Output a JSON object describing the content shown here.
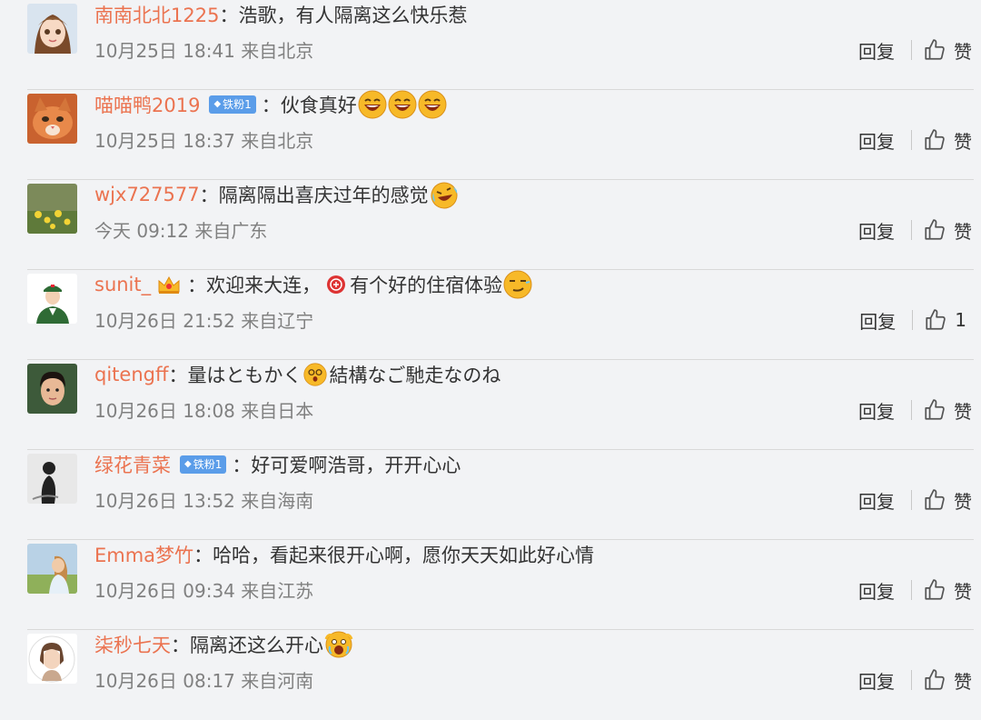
{
  "colon": "：",
  "comments": [
    {
      "user": "南南北北1225",
      "badge": null,
      "text": "浩歌，有人隔离这么快乐惹",
      "time": "10月25日 18:41 来自北京",
      "reply": "回复",
      "like": "赞",
      "avatar": "cartoon-girl"
    },
    {
      "user": "喵喵鸭2019",
      "badge": "铁粉1",
      "text": "伙食真好",
      "time": "10月25日 18:37 来自北京",
      "reply": "回复",
      "like": "赞",
      "avatar": "cat",
      "emojis": [
        "laughing-emoji",
        "laughing-emoji",
        "laughing-emoji"
      ]
    },
    {
      "user": "wjx727577",
      "badge": null,
      "text": "隔离隔出喜庆过年的感觉",
      "time": "今天 09:12 来自广东",
      "reply": "回复",
      "like": "赞",
      "avatar": "flowers",
      "emojis": [
        "crying-laughing-emoji"
      ]
    },
    {
      "user": "sunit_",
      "badge": null,
      "crown": true,
      "text_a": "欢迎来大连，",
      "text_b": "有个好的住宿体验",
      "time": "10月26日 21:52 来自辽宁",
      "reply": "回复",
      "like": "1",
      "avatar": "soldier",
      "emojis": [
        "smirk-emoji"
      ]
    },
    {
      "user": "qitengff",
      "badge": null,
      "text_a": "量はともかく",
      "text_b": "結構なご馳走なのね",
      "time": "10月26日 18:08 来自日本",
      "reply": "回复",
      "like": "赞",
      "avatar": "man",
      "emojis": [
        "dizzy-emoji"
      ]
    },
    {
      "user": "绿花青菜",
      "badge": "铁粉1",
      "text": "好可爱啊浩哥，开开心心",
      "time": "10月26日 13:52 来自海南",
      "reply": "回复",
      "like": "赞",
      "avatar": "silhouette"
    },
    {
      "user": "Emma梦竹",
      "badge": null,
      "text": "哈哈，看起来很开心啊，愿你天天如此好心情",
      "time": "10月26日 09:34 来自江苏",
      "reply": "回复",
      "like": "赞",
      "avatar": "woman"
    },
    {
      "user": "柒秒七天",
      "badge": null,
      "text": "隔离还这么开心",
      "time": "10月26日 08:17 来自河南",
      "reply": "回复",
      "like": "赞",
      "avatar": "round-face",
      "emojis": [
        "screaming-emoji"
      ]
    }
  ],
  "colors": {
    "username": "#eb7350",
    "meta": "#808080",
    "badge": "#5b9de9",
    "divider": "#d9d9d9"
  }
}
